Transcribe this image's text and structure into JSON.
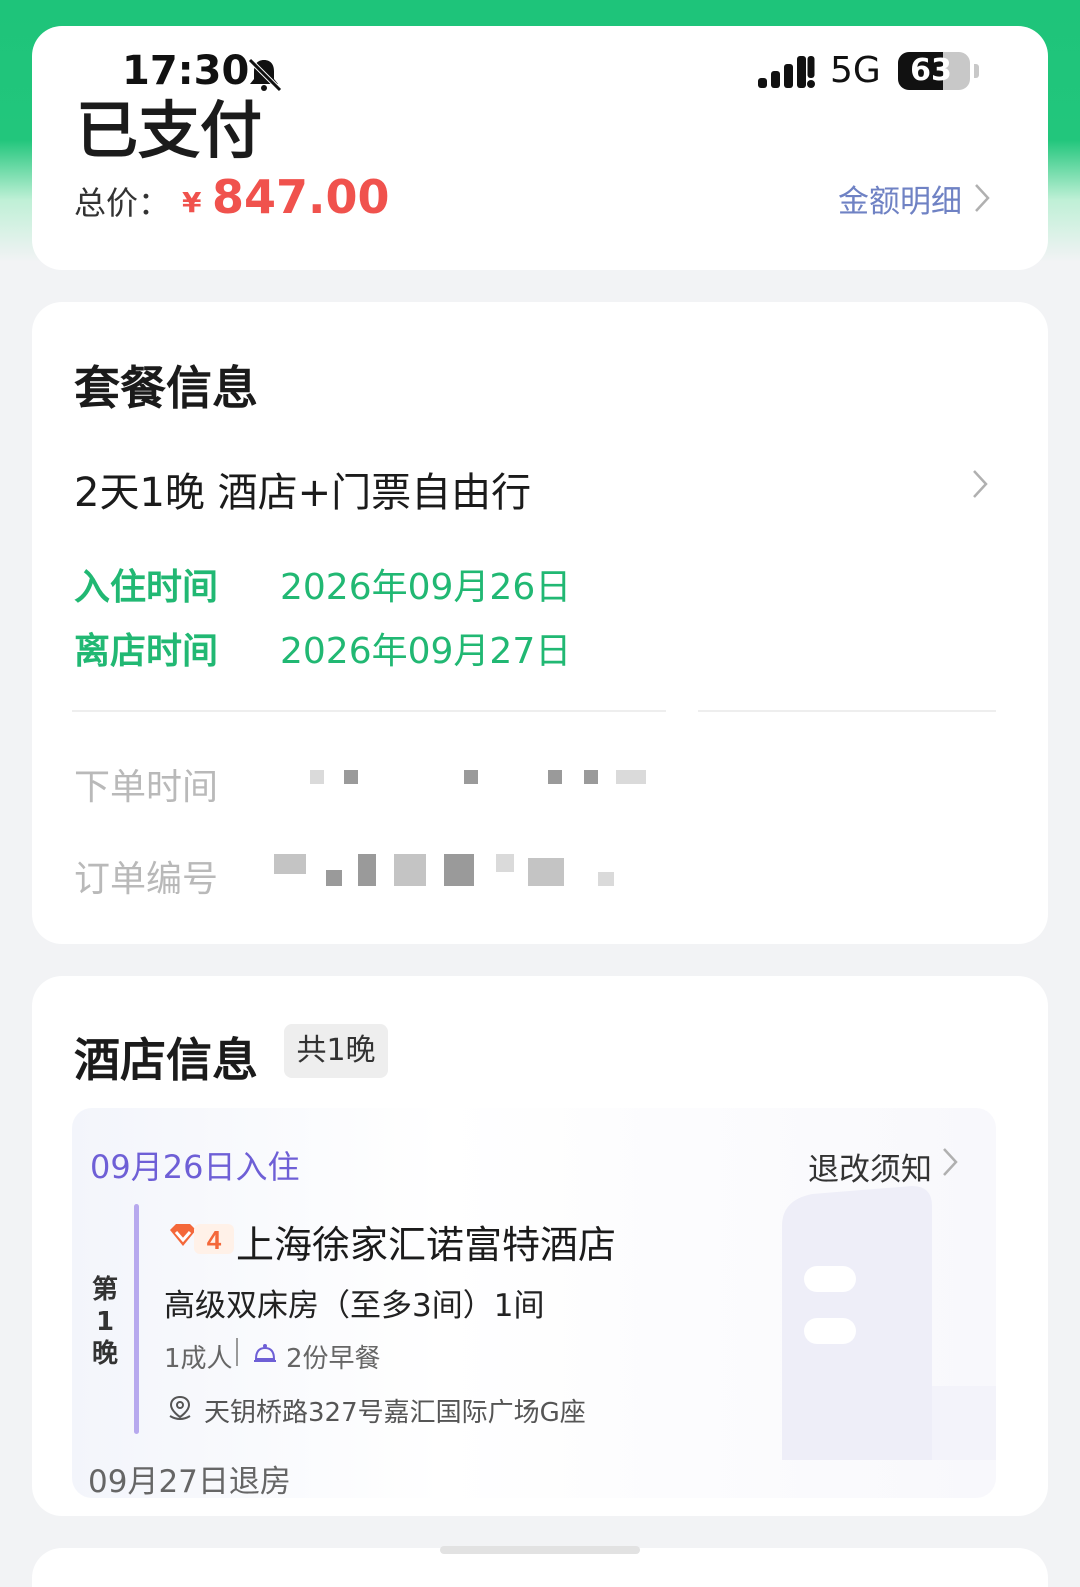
{
  "status_bar": {
    "time": "17:30",
    "network": "5G",
    "battery": "63",
    "battery_level": 0.63
  },
  "order_status": {
    "title": "已支付",
    "price_label": "总价：",
    "currency": "¥",
    "price": "847.00",
    "detail_link": "金额明细"
  },
  "package": {
    "section_title": "套餐信息",
    "name": "2天1晚 酒店+门票自由行",
    "checkin_label": "入住时间",
    "checkin_date": "2026年09月26日",
    "checkout_label": "离店时间",
    "checkout_date": "2026年09月27日",
    "order_time_label": "下单时间",
    "order_no_label": "订单编号"
  },
  "hotel": {
    "section_title": "酒店信息",
    "nights_badge": "共1晚",
    "checkin_title": "09月26日入住",
    "refund_notice": "退改须知",
    "night_label": "第1晚",
    "diamond_level": "4",
    "name": "上海徐家汇诺富特酒店",
    "room": "高级双床房（至多3间）1间",
    "guests": "1成人",
    "breakfast": "2份早餐",
    "address": "天钥桥路327号嘉汇国际广场G座",
    "checkout": "09月27日退房"
  },
  "colors": {
    "brand_green": "#21b873",
    "price_red": "#f0524d",
    "link_blue": "#6f82c4",
    "accent_purple": "#6e5fd6"
  }
}
